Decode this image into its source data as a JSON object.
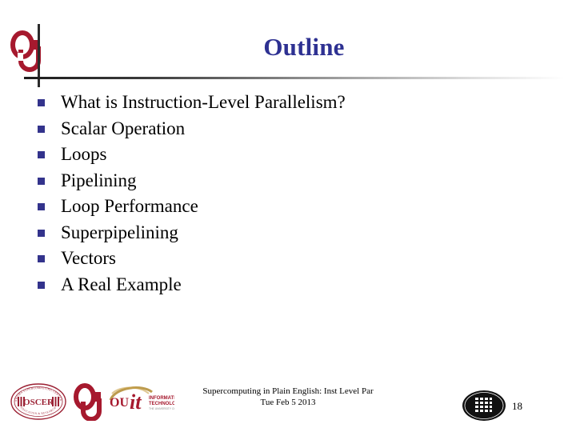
{
  "slide": {
    "title": "Outline",
    "title_color": "#2E3192",
    "bullet_color": "#33338C",
    "accent_crimson": "#A6192E",
    "page_number": "18"
  },
  "header": {
    "ou_logo_alt": "OU",
    "ou_logo_letters": "OU"
  },
  "outline": {
    "items": [
      {
        "label": "What is Instruction-Level Parallelism?"
      },
      {
        "label": "Scalar Operation"
      },
      {
        "label": "Loops"
      },
      {
        "label": "Pipelining"
      },
      {
        "label": "Loop Performance"
      },
      {
        "label": "Superpipelining"
      },
      {
        "label": "Vectors"
      },
      {
        "label": "A Real Example"
      }
    ]
  },
  "footer": {
    "line1": "Supercomputing in Plain English: Inst Level Par",
    "line2": "Tue Feb 5 2013",
    "logos": {
      "oscer_text": "OSCER",
      "oscer_ring_top": "OKLAHOMA  SUPERCOMPUTING  CENTER  FOR",
      "oscer_ring_bottom": "EDUCATION  &  RESEARCH",
      "ou_text": "OU",
      "it_text": "it",
      "it_sub1": "INFORMATION",
      "it_sub2": "TECHNOLOGY",
      "it_sub3": "THE UNIVERSITY OF OKLAHOMA"
    },
    "seal_alt": "university-seal"
  }
}
